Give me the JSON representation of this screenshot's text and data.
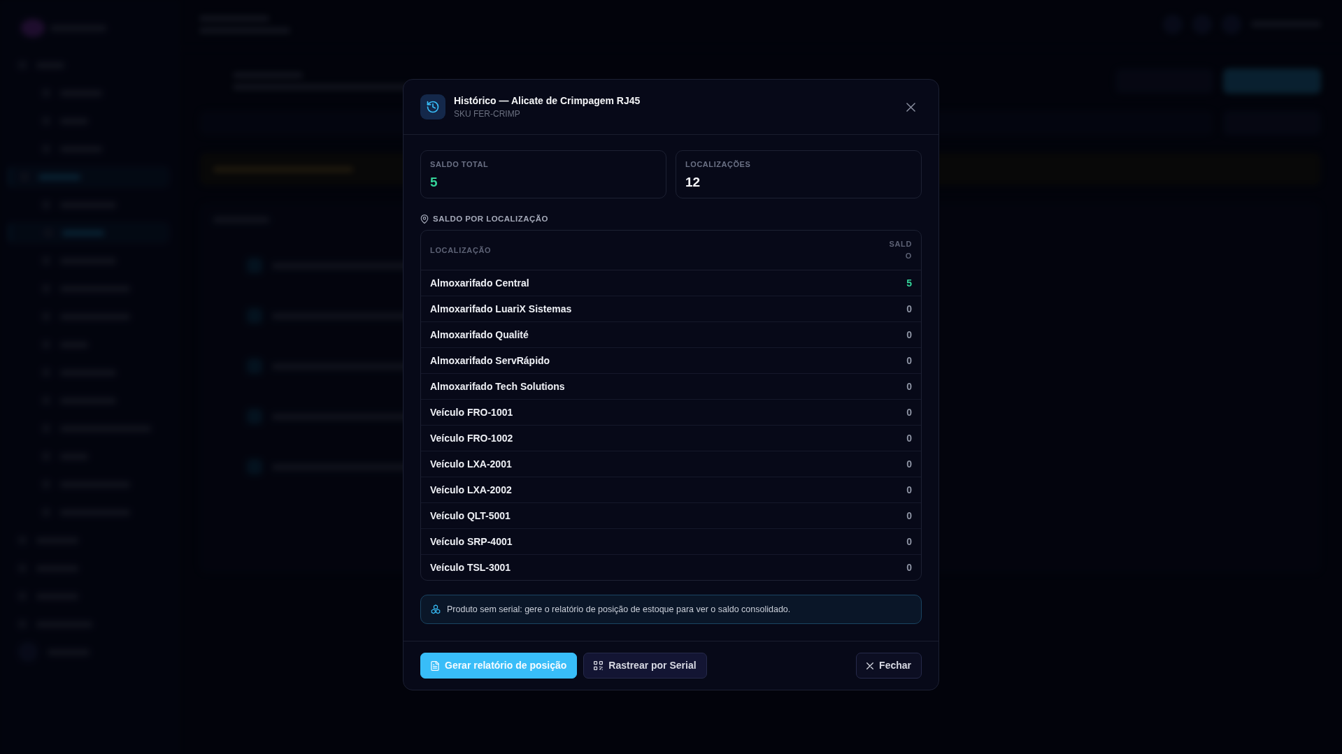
{
  "modal": {
    "title": "Histórico — Alicate de Crimpagem RJ45",
    "subtitle": "SKU FER-CRIMP"
  },
  "stats": [
    {
      "label": "SALDO TOTAL",
      "value": "5",
      "color": "#34d399"
    },
    {
      "label": "LOCALIZAÇÕES",
      "value": "12",
      "color": "#f5f6fa"
    }
  ],
  "section": {
    "title": "SALDO POR LOCALIZAÇÃO"
  },
  "table": {
    "columns": [
      "LOCALIZAÇÃO",
      "SALDO"
    ],
    "rows": [
      {
        "location": "Almoxarifado Central",
        "balance": "5",
        "color": "#34d399"
      },
      {
        "location": "Almoxarifado LuariX Sistemas",
        "balance": "0",
        "color": "#8d93a3"
      },
      {
        "location": "Almoxarifado Qualité",
        "balance": "0",
        "color": "#8d93a3"
      },
      {
        "location": "Almoxarifado ServRápido",
        "balance": "0",
        "color": "#8d93a3"
      },
      {
        "location": "Almoxarifado Tech Solutions",
        "balance": "0",
        "color": "#8d93a3"
      },
      {
        "location": "Veículo FRO-1001",
        "balance": "0",
        "color": "#8d93a3"
      },
      {
        "location": "Veículo FRO-1002",
        "balance": "0",
        "color": "#8d93a3"
      },
      {
        "location": "Veículo LXA-2001",
        "balance": "0",
        "color": "#8d93a3"
      },
      {
        "location": "Veículo LXA-2002",
        "balance": "0",
        "color": "#8d93a3"
      },
      {
        "location": "Veículo QLT-5001",
        "balance": "0",
        "color": "#8d93a3"
      },
      {
        "location": "Veículo SRP-4001",
        "balance": "0",
        "color": "#8d93a3"
      },
      {
        "location": "Veículo TSL-3001",
        "balance": "0",
        "color": "#8d93a3"
      }
    ]
  },
  "notice": {
    "text": "Produto sem serial: gere o relatório de posição de estoque para ver o saldo consolidado."
  },
  "buttons": [
    {
      "label": "Gerar relatório de posição",
      "kind": "primary"
    },
    {
      "label": "Rastrear por Serial",
      "kind": "secondary"
    },
    {
      "label": "Fechar",
      "kind": "dismiss"
    }
  ]
}
